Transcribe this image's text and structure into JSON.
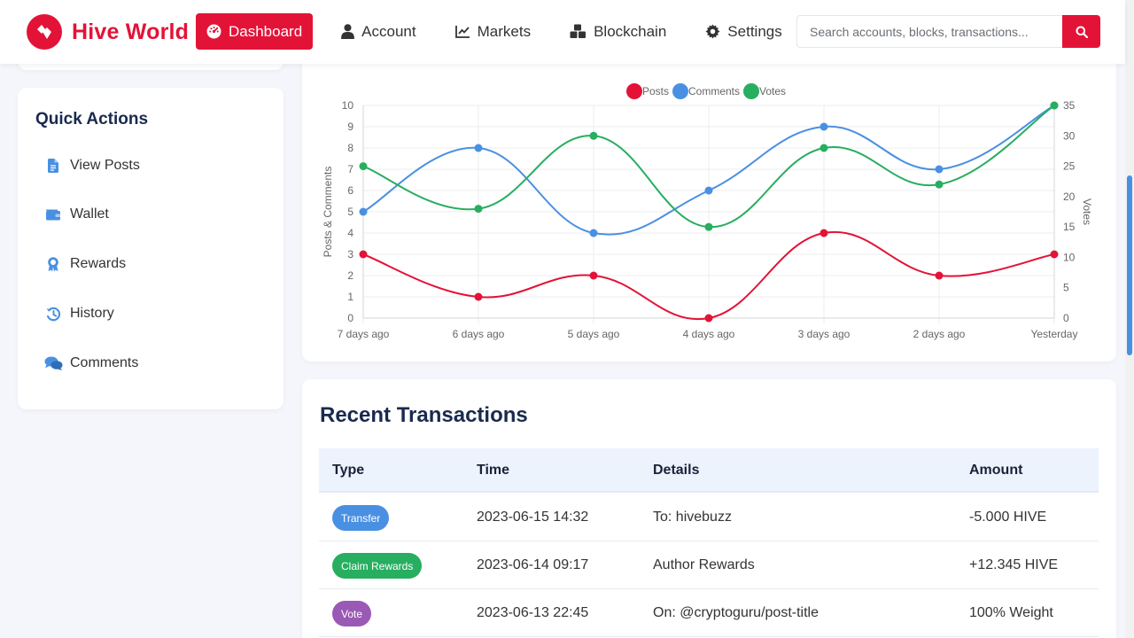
{
  "brand": {
    "name": "Hive World",
    "color": "#e31337"
  },
  "nav": [
    {
      "label": "Dashboard",
      "icon": "dashboard-icon",
      "active": true
    },
    {
      "label": "Account",
      "icon": "user-icon"
    },
    {
      "label": "Markets",
      "icon": "chart-line-icon"
    },
    {
      "label": "Blockchain",
      "icon": "cubes-icon"
    },
    {
      "label": "Settings",
      "icon": "gear-icon"
    }
  ],
  "search": {
    "placeholder": "Search accounts, blocks, transactions...",
    "value": ""
  },
  "sidebar": {
    "title": "Quick Actions",
    "items": [
      {
        "label": "View Posts",
        "icon": "file-icon"
      },
      {
        "label": "Wallet",
        "icon": "wallet-icon"
      },
      {
        "label": "Rewards",
        "icon": "award-icon"
      },
      {
        "label": "History",
        "icon": "history-icon"
      },
      {
        "label": "Comments",
        "icon": "comments-icon"
      }
    ]
  },
  "chart_data": {
    "type": "line",
    "categories": [
      "7 days ago",
      "6 days ago",
      "5 days ago",
      "4 days ago",
      "3 days ago",
      "2 days ago",
      "Yesterday"
    ],
    "series": [
      {
        "name": "Posts",
        "axis": "left",
        "color": "#e31337",
        "values": [
          3,
          1,
          2,
          0,
          4,
          2,
          3
        ]
      },
      {
        "name": "Comments",
        "axis": "left",
        "color": "#4a90e2",
        "values": [
          5,
          8,
          4,
          6,
          9,
          7,
          10
        ]
      },
      {
        "name": "Votes",
        "axis": "right",
        "color": "#27ae60",
        "values": [
          25,
          18,
          30,
          15,
          28,
          22,
          35
        ]
      }
    ],
    "ylabel": "Posts & Comments",
    "ylim": [
      0,
      10
    ],
    "yticks": [
      0,
      1,
      2,
      3,
      4,
      5,
      6,
      7,
      8,
      9,
      10
    ],
    "y2label": "Votes",
    "y2lim": [
      0,
      35
    ],
    "y2ticks": [
      0,
      5,
      10,
      15,
      20,
      25,
      30,
      35
    ],
    "legend": "top-center",
    "grid": true
  },
  "transactions": {
    "title": "Recent Transactions",
    "headers": [
      "Type",
      "Time",
      "Details",
      "Amount"
    ],
    "rows": [
      {
        "type": "Transfer",
        "color": "#4a90e2",
        "time": "2023-06-15 14:32",
        "details": "To: hivebuzz",
        "amount": "-5.000 HIVE"
      },
      {
        "type": "Claim Rewards",
        "color": "#27ae60",
        "time": "2023-06-14 09:17",
        "details": "Author Rewards",
        "amount": "+12.345 HIVE"
      },
      {
        "type": "Vote",
        "color": "#9b59b6",
        "time": "2023-06-13 22:45",
        "details": "On: @cryptoguru/post-title",
        "amount": "100% Weight"
      }
    ]
  }
}
